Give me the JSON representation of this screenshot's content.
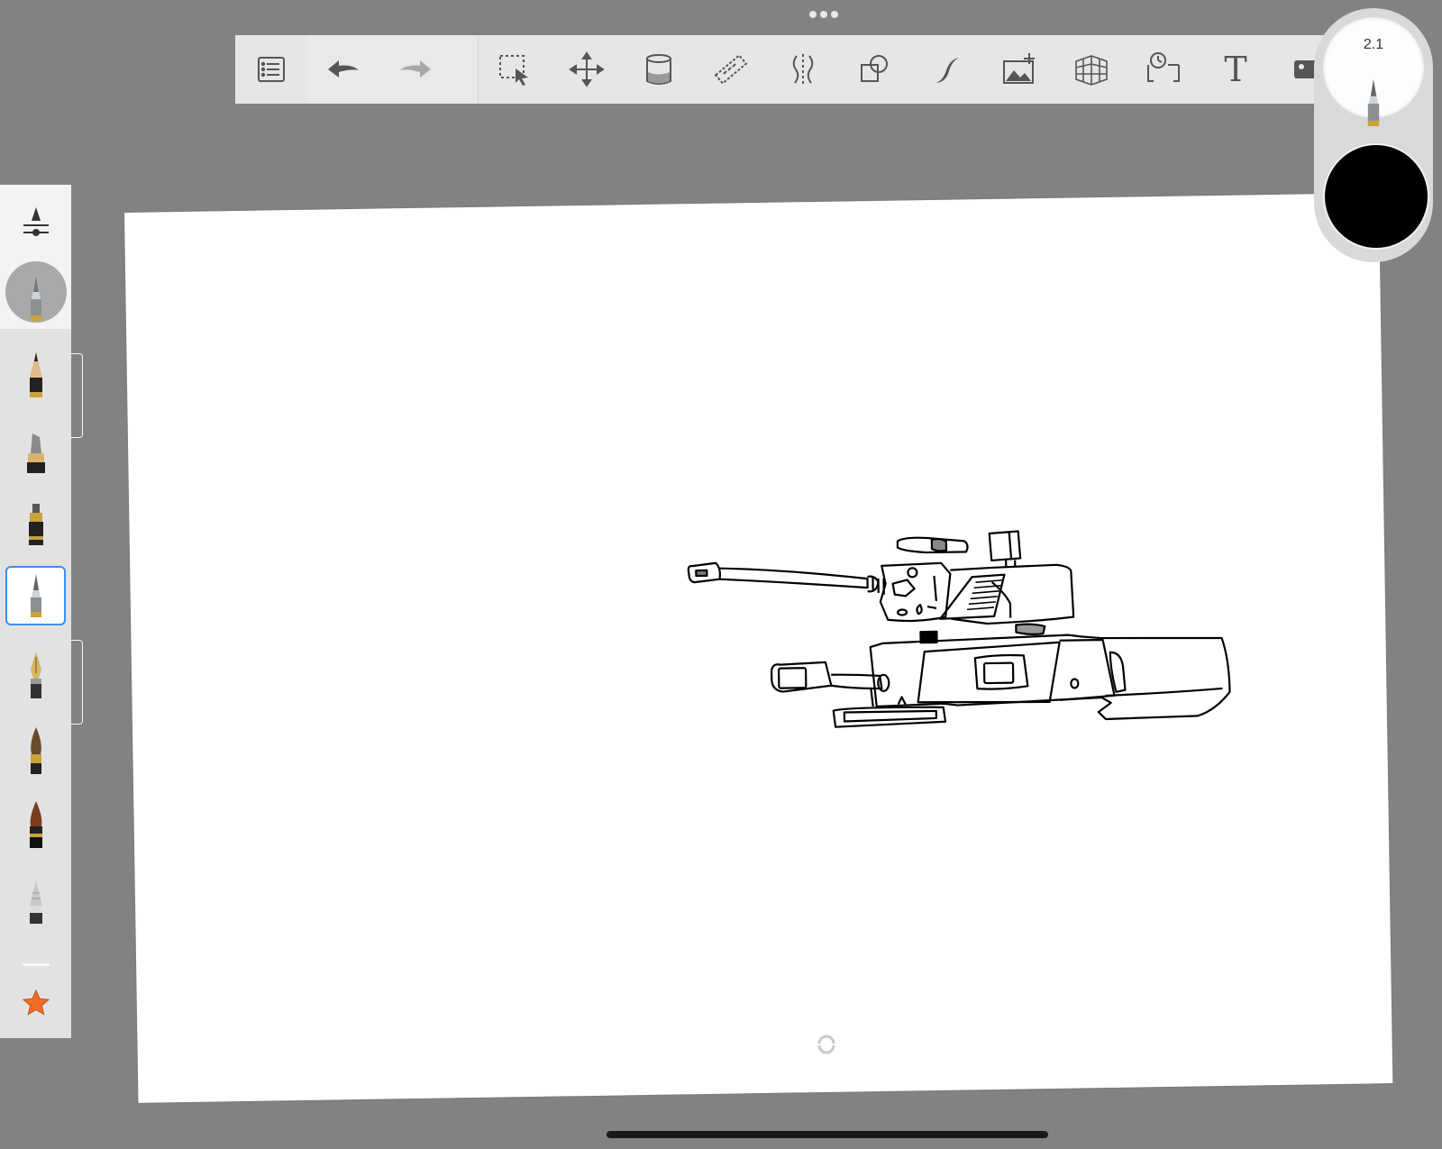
{
  "toolbar": {
    "items": [
      {
        "name": "layers-list-icon"
      },
      {
        "name": "undo-icon"
      },
      {
        "name": "redo-icon"
      },
      {
        "name": "selection-icon"
      },
      {
        "name": "transform-icon"
      },
      {
        "name": "fill-bucket-icon"
      },
      {
        "name": "ruler-icon"
      },
      {
        "name": "symmetry-icon"
      },
      {
        "name": "shapes-icon"
      },
      {
        "name": "stroke-curve-icon"
      },
      {
        "name": "add-image-icon"
      },
      {
        "name": "perspective-grid-icon"
      },
      {
        "name": "timelapse-icon"
      },
      {
        "name": "text-icon",
        "label": "T"
      },
      {
        "name": "record-icon"
      }
    ]
  },
  "brush_size": {
    "value": "2.1"
  },
  "current_color": "#000000",
  "accent_color": "#3b8ff0",
  "favorite_color": "#f26b24",
  "brushes": [
    "pencil",
    "marker",
    "ink-pen",
    "ballpoint-pen",
    "fountain-pen",
    "paint-brush",
    "watercolor-brush",
    "airbrush",
    "eraser"
  ],
  "selected_brush": "ballpoint-pen"
}
